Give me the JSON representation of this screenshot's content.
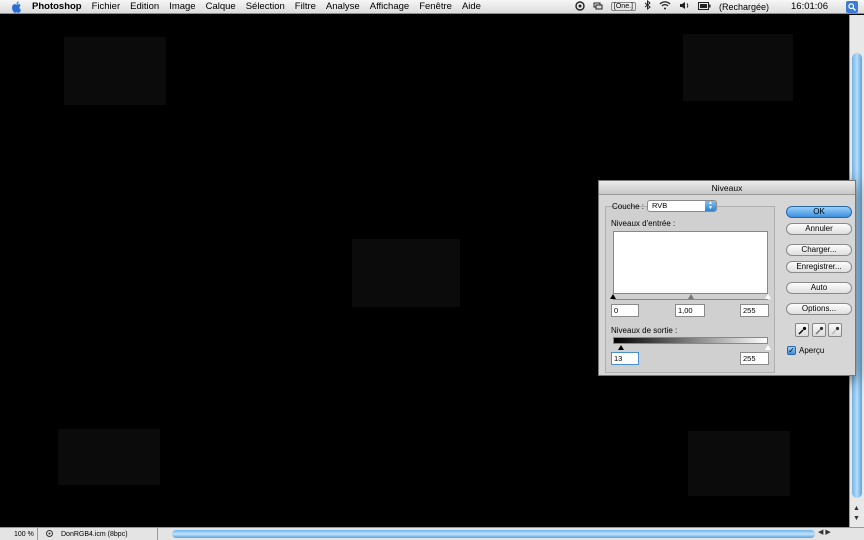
{
  "menubar": {
    "app": "Photoshop",
    "items": [
      "Fichier",
      "Edition",
      "Image",
      "Calque",
      "Sélection",
      "Filtre",
      "Analyse",
      "Affichage",
      "Fenêtre",
      "Aide"
    ],
    "user_badge": "[One.]",
    "battery": "(Rechargée)",
    "clock": "16:01:06"
  },
  "statusbar": {
    "zoom": "100 %",
    "doc_profile": "DonRGB4.icm (8bpc)"
  },
  "dialog": {
    "title": "Niveaux",
    "channel_label": "Couche :",
    "channel_value": "RVB",
    "input_levels_label": "Niveaux d'entrée :",
    "input_black": "0",
    "input_gamma": "1,00",
    "input_white": "255",
    "output_levels_label": "Niveaux de sortie :",
    "output_black": "13",
    "output_white": "255",
    "buttons": {
      "ok": "OK",
      "cancel": "Annuler",
      "load": "Charger...",
      "save": "Enregistrer...",
      "auto": "Auto",
      "options": "Options..."
    },
    "preview_label": "Aperçu",
    "preview_checked": true
  },
  "colors": {
    "accent": "#3e8fdd",
    "canvas": "#000000",
    "patch": "#0b0b0b"
  }
}
